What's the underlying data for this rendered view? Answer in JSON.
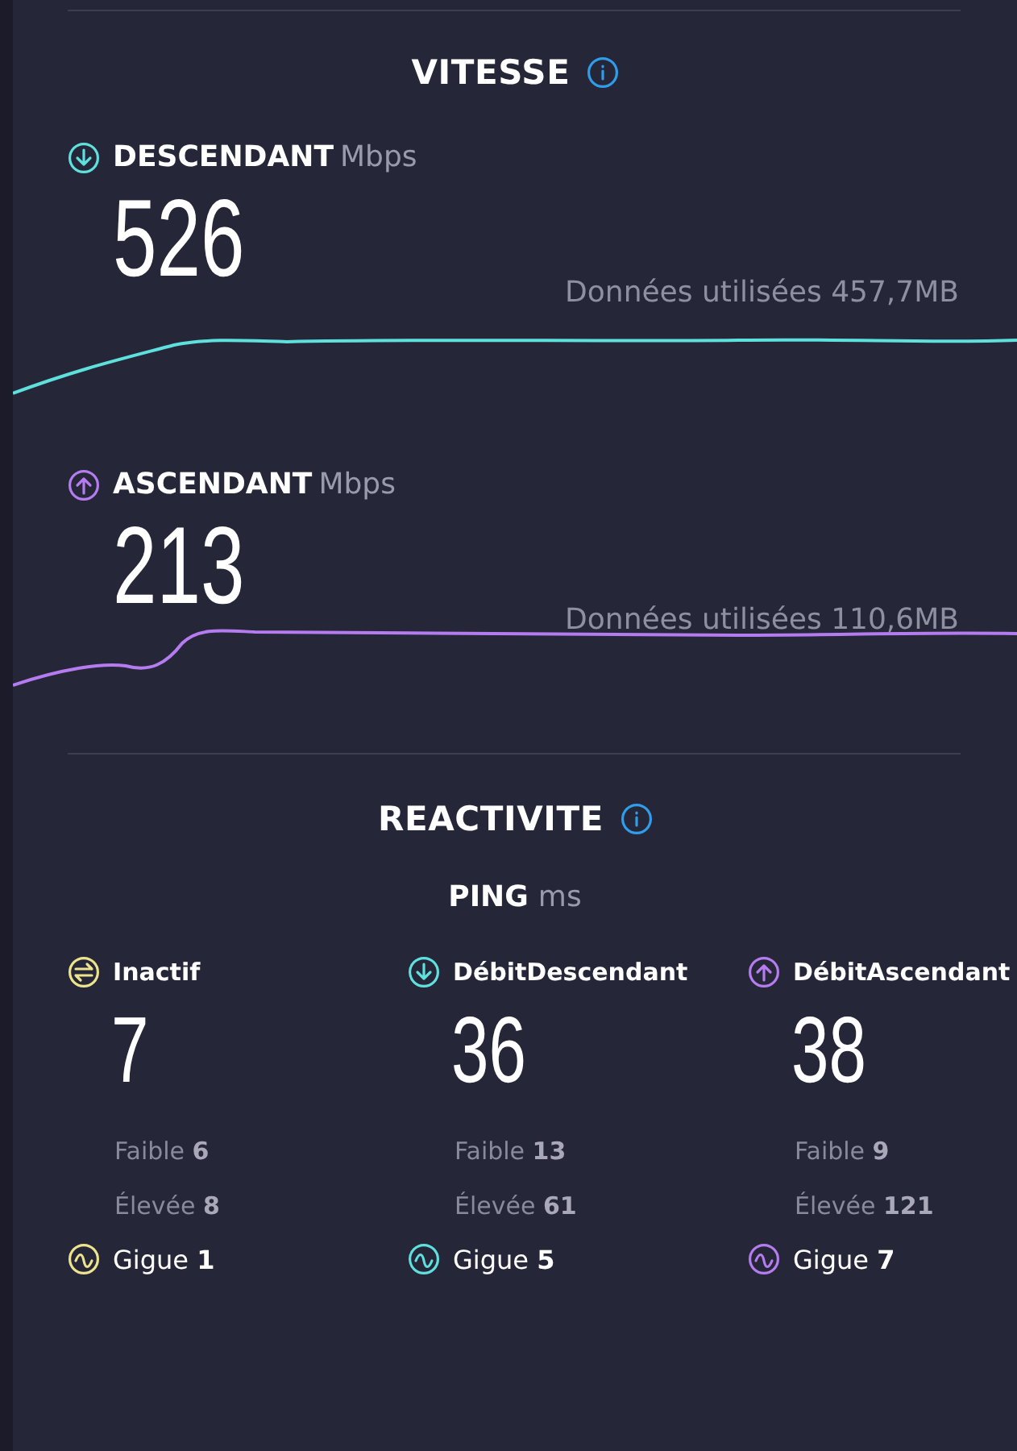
{
  "speed": {
    "title": "VITESSE",
    "metrics": [
      {
        "kind": "download",
        "label": "DESCENDANT",
        "unit": "Mbps",
        "value": "526",
        "data_used": "Données utilisées 457,7MB",
        "color": "#5ee0dc"
      },
      {
        "kind": "upload",
        "label": "ASCENDANT",
        "unit": "Mbps",
        "value": "213",
        "data_used": "Données utilisées 110,6MB",
        "color": "#b57cf0"
      }
    ]
  },
  "responsiveness": {
    "title": "REACTIVITE",
    "ping_label": "PING",
    "ping_unit": "ms",
    "columns": [
      {
        "kind": "idle",
        "label": "Inactif",
        "value": "7",
        "low": "Faible **6**",
        "high": "Élevée **8**",
        "jitter": "Gigue **1**",
        "color": "#ece38c"
      },
      {
        "kind": "download",
        "label": "DébitDescendant",
        "value": "36",
        "low": "Faible **13**",
        "high": "Élevée **61**",
        "jitter": "Gigue **5**",
        "color": "#5ee0dc"
      },
      {
        "kind": "upload",
        "label": "DébitAscendant",
        "value": "38",
        "low": "Faible **9**",
        "high": "Élevée **121**",
        "jitter": "Gigue **7**",
        "color": "#b57cf0"
      }
    ]
  }
}
